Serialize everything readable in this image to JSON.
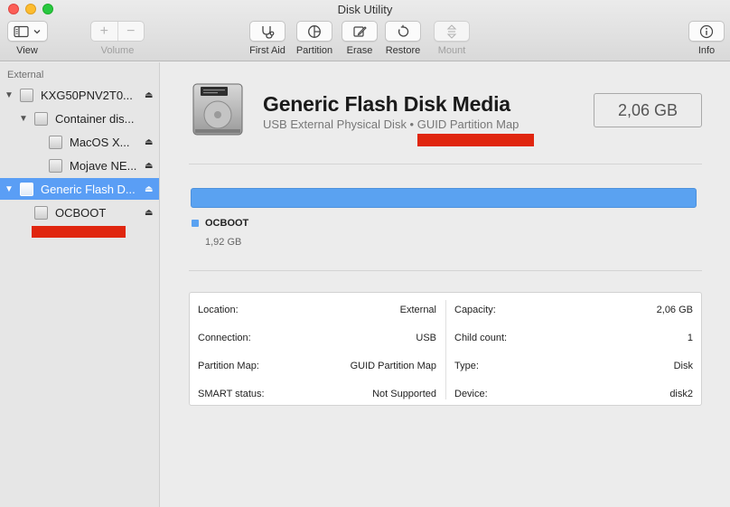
{
  "window": {
    "title": "Disk Utility"
  },
  "toolbar": {
    "view_label": "View",
    "volume_label": "Volume",
    "first_aid_label": "First Aid",
    "partition_label": "Partition",
    "erase_label": "Erase",
    "restore_label": "Restore",
    "mount_label": "Mount",
    "info_label": "Info"
  },
  "sidebar": {
    "section": "External",
    "items": [
      {
        "label": "KXG50PNV2T0..."
      },
      {
        "label": "Container dis..."
      },
      {
        "label": "MacOS X..."
      },
      {
        "label": "Mojave NE..."
      },
      {
        "label": "Generic Flash D..."
      },
      {
        "label": "OCBOOT"
      }
    ]
  },
  "disk": {
    "title": "Generic Flash Disk Media",
    "subtitle": "USB External Physical Disk • GUID Partition Map",
    "size": "2,06 GB"
  },
  "partition": {
    "name": "OCBOOT",
    "size": "1,92 GB",
    "fraction": 1.0,
    "color": "#5aa2f1"
  },
  "info": {
    "location_key": "Location:",
    "location_val": "External",
    "connection_key": "Connection:",
    "connection_val": "USB",
    "partition_map_key": "Partition Map:",
    "partition_map_val": "GUID Partition Map",
    "smart_key": "SMART status:",
    "smart_val": "Not Supported",
    "capacity_key": "Capacity:",
    "capacity_val": "2,06 GB",
    "child_count_key": "Child count:",
    "child_count_val": "1",
    "type_key": "Type:",
    "type_val": "Disk",
    "device_key": "Device:",
    "device_val": "disk2"
  },
  "colors": {
    "accent": "#5a9ef5",
    "redaction": "#e0260f"
  }
}
